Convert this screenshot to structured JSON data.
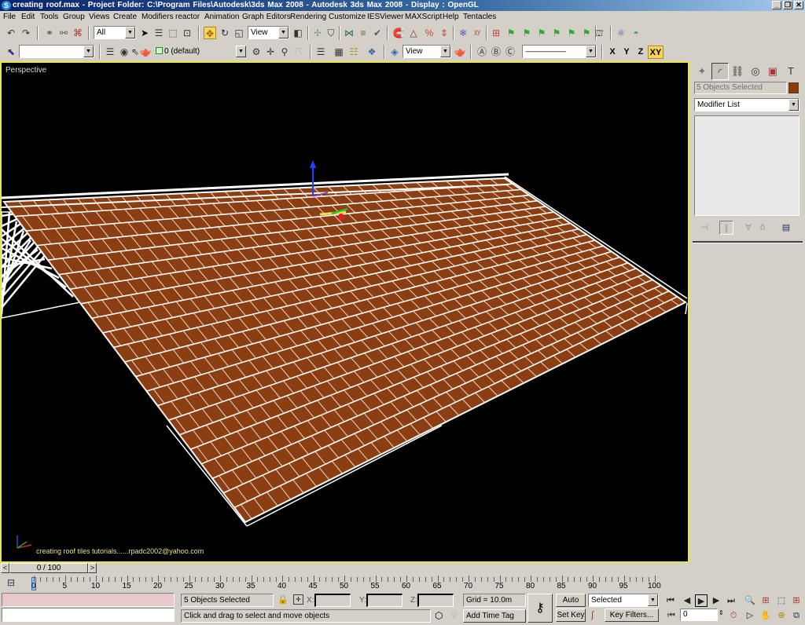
{
  "window": {
    "title": "creating roof.max     - Project Folder: C:\\Program Files\\Autodesk\\3ds Max 2008     - Autodesk 3ds Max 2008     - Display : OpenGL",
    "app_icon": "3ds-max-icon",
    "controls": {
      "minimize": "_",
      "restore": "❐",
      "close": "✕"
    }
  },
  "menu": [
    "File",
    "Edit",
    "Tools",
    "Group",
    "Views",
    "Create",
    "Modifiers",
    "reactor",
    "Animation",
    "Graph Editors",
    "Rendering",
    "Customize",
    "IESViewer",
    "MAXScript",
    "Help",
    "Tentacles"
  ],
  "main_toolbar": {
    "selection_filter": "All",
    "reference_coord": "View",
    "icons": [
      "undo",
      "redo",
      "select-and-link",
      "unlink-selection",
      "bind-to-space-warp",
      "select-object",
      "select-by-name",
      "rectangular-selection-region",
      "window-crossing",
      "select-and-move",
      "select-and-rotate",
      "select-and-scale",
      "use-pivot-center",
      "select-and-manipulate",
      "keyboard-shortcut-override",
      "mirror",
      "align",
      "named-selection",
      "3d-snaps",
      "angle-snap",
      "percent-snap",
      "spinner-snap",
      "edit-named-selections",
      "layer-manager",
      "curve-editor",
      "schematic-view",
      "material-editor",
      "render-scene",
      "quick-render"
    ]
  },
  "secondary_toolbar": {
    "named_selection": "",
    "layer": "0 (default)",
    "render_view": "View",
    "render_preset": "-------------------------------",
    "axis_constraints": [
      "X",
      "Y",
      "Z",
      "XY"
    ],
    "active_axis": "XY"
  },
  "viewport": {
    "label": "Perspective",
    "credit_text": "creating roof tiles tutorials......rpadc2002@yahoo.com",
    "tile_color": "#8b3e12",
    "border_color": "#e6e64a"
  },
  "command_panel": {
    "tabs": [
      "create",
      "modify",
      "hierarchy",
      "motion",
      "display",
      "utilities"
    ],
    "active_tab": "modify",
    "selection_name": "5 Objects Selected",
    "object_color": "#8b3a0e",
    "modifier_list": "Modifier List",
    "stack_buttons": [
      "pin-stack",
      "show-end-result",
      "make-unique",
      "remove-modifier",
      "configure-modifier-sets"
    ]
  },
  "timeline": {
    "slider_label": "0 / 100",
    "prev": "<",
    "next": ">",
    "current_frame": 0,
    "total_frames": 100,
    "ticks": [
      "0",
      "5",
      "10",
      "15",
      "20",
      "25",
      "30",
      "35",
      "40",
      "45",
      "50",
      "55",
      "60",
      "65",
      "70",
      "75",
      "80",
      "85",
      "90",
      "95",
      "100"
    ]
  },
  "status": {
    "selection_info": "5 Objects Selected",
    "prompt": "Click and drag to select and move objects",
    "x_label": "X:",
    "y_label": "Y:",
    "z_label": "Z:",
    "x_value": "",
    "y_value": "",
    "z_value": "",
    "grid": "Grid = 10.0m",
    "add_time_tag": "Add Time Tag",
    "auto_key": "Auto Key",
    "set_key": "Set Key",
    "key_mode": "Selected",
    "key_filters": "Key Filters...",
    "frame_field": "0"
  }
}
